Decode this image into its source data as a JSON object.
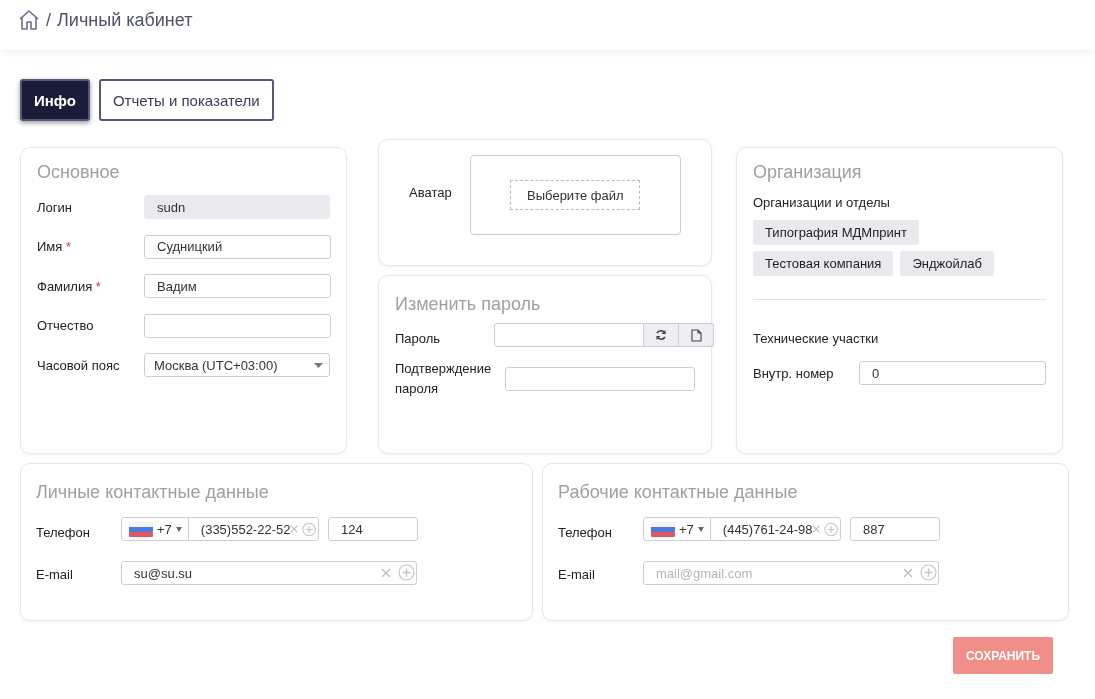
{
  "breadcrumb": {
    "separator": "/",
    "title": "Личный кабинет"
  },
  "tabs": [
    {
      "label": "Инфо",
      "selected": true
    },
    {
      "label": "Отчеты и показатели",
      "selected": false
    }
  ],
  "main": {
    "title": "Основное",
    "fields": [
      {
        "label": "Логин",
        "kind": "readonly",
        "value": "sudn"
      },
      {
        "label": "Имя",
        "kind": "text",
        "value": "Судницкий",
        "required_mark": "*"
      },
      {
        "label": "Фамилия",
        "kind": "text",
        "value": "Вадим",
        "required_mark": "*"
      },
      {
        "label": "Отчество",
        "kind": "text"
      },
      {
        "label": "Часовой пояс",
        "kind": "select",
        "value": "Москва (UTC+03:00)"
      }
    ]
  },
  "avatar": {
    "label": "Аватар",
    "button": "Выберите файл"
  },
  "password": {
    "title": "Изменить пароль",
    "fields": [
      {
        "label": "Пароль",
        "kind": "generator"
      },
      {
        "label": "Подтверждение пароля",
        "kind": "text"
      }
    ]
  },
  "organization": {
    "title": "Организация",
    "orgs_label": "Организации и отделы",
    "orgs": [
      "Типография МДМпринт",
      "Тестовая компания",
      "Энджойлаб"
    ],
    "sections_label": "Технические участки",
    "internal_number": {
      "label": "Внутр. номер",
      "value": "0"
    }
  },
  "contacts": [
    {
      "title": "Личные контактные данные",
      "phone": {
        "label": "Телефон",
        "code": "+7",
        "number": "(335)552-22-52",
        "ext": "124"
      },
      "email": {
        "label": "E-mail",
        "value": "su@su.su"
      }
    },
    {
      "title": "Рабочие контактные данные",
      "phone": {
        "label": "Телефон",
        "code": "+7",
        "number": "(445)761-24-98",
        "ext": "887"
      },
      "email": {
        "label": "E-mail",
        "placeholder": "mail@gmail.com"
      }
    }
  ],
  "save": {
    "label": "СОХРАНИТЬ",
    "disabled": true
  }
}
